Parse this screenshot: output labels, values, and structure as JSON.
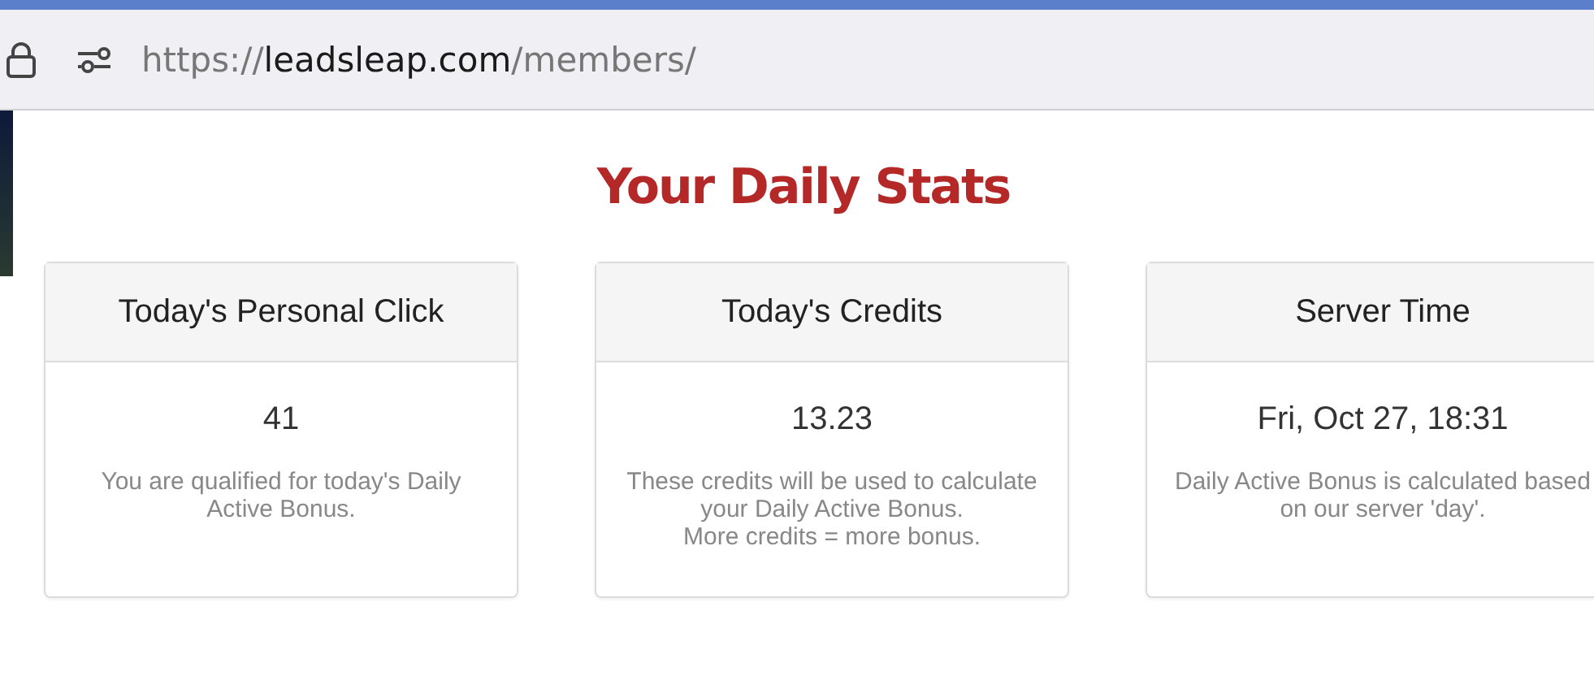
{
  "browser": {
    "url": {
      "scheme": "https://",
      "host": "leadsleap.com",
      "path": "/members/"
    }
  },
  "title": "Your Daily Stats",
  "cards": [
    {
      "heading": "Today's Personal Click",
      "value": "41",
      "description": [
        "You are qualified for today's Daily Active Bonus."
      ]
    },
    {
      "heading": "Today's Credits",
      "value": "13.23",
      "description": [
        "These credits will be used to calculate your Daily Active Bonus.",
        "More credits = more bonus."
      ]
    },
    {
      "heading": "Server Time",
      "value": "Fri, Oct 27, 18:31",
      "description": [
        "Daily Active Bonus is calculated based on our server 'day'."
      ]
    }
  ]
}
